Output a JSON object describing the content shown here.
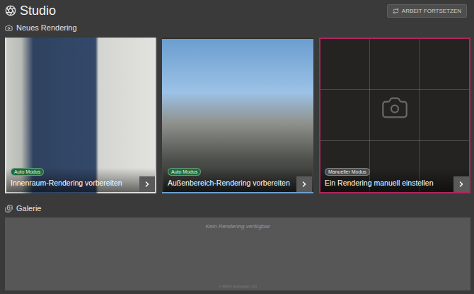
{
  "header": {
    "title": "Studio",
    "action_button": "ARBEIT FORTSETZEN"
  },
  "new_rendering": {
    "title": "Neues Rendering",
    "cards": [
      {
        "kind": "interior",
        "badge": "Auto Modus",
        "badge_color": "#1f6b3a",
        "title": "Innenraum-Rendering vorbereiten",
        "selected": false
      },
      {
        "kind": "exterior",
        "badge": "Auto Modus",
        "badge_color": "#1f6b3a",
        "title": "Außenbereich-Rendering vorbereiten",
        "selected": false
      },
      {
        "kind": "manual",
        "badge": "Manueller Modus",
        "badge_color": "#4a4a4a",
        "title": "Ein Rendering manuell einstellen",
        "selected": true
      }
    ]
  },
  "gallery": {
    "title": "Galerie",
    "empty_text": "Kein Rendering verfügbar",
    "more": "+ Mehr anzeigen (0)"
  }
}
